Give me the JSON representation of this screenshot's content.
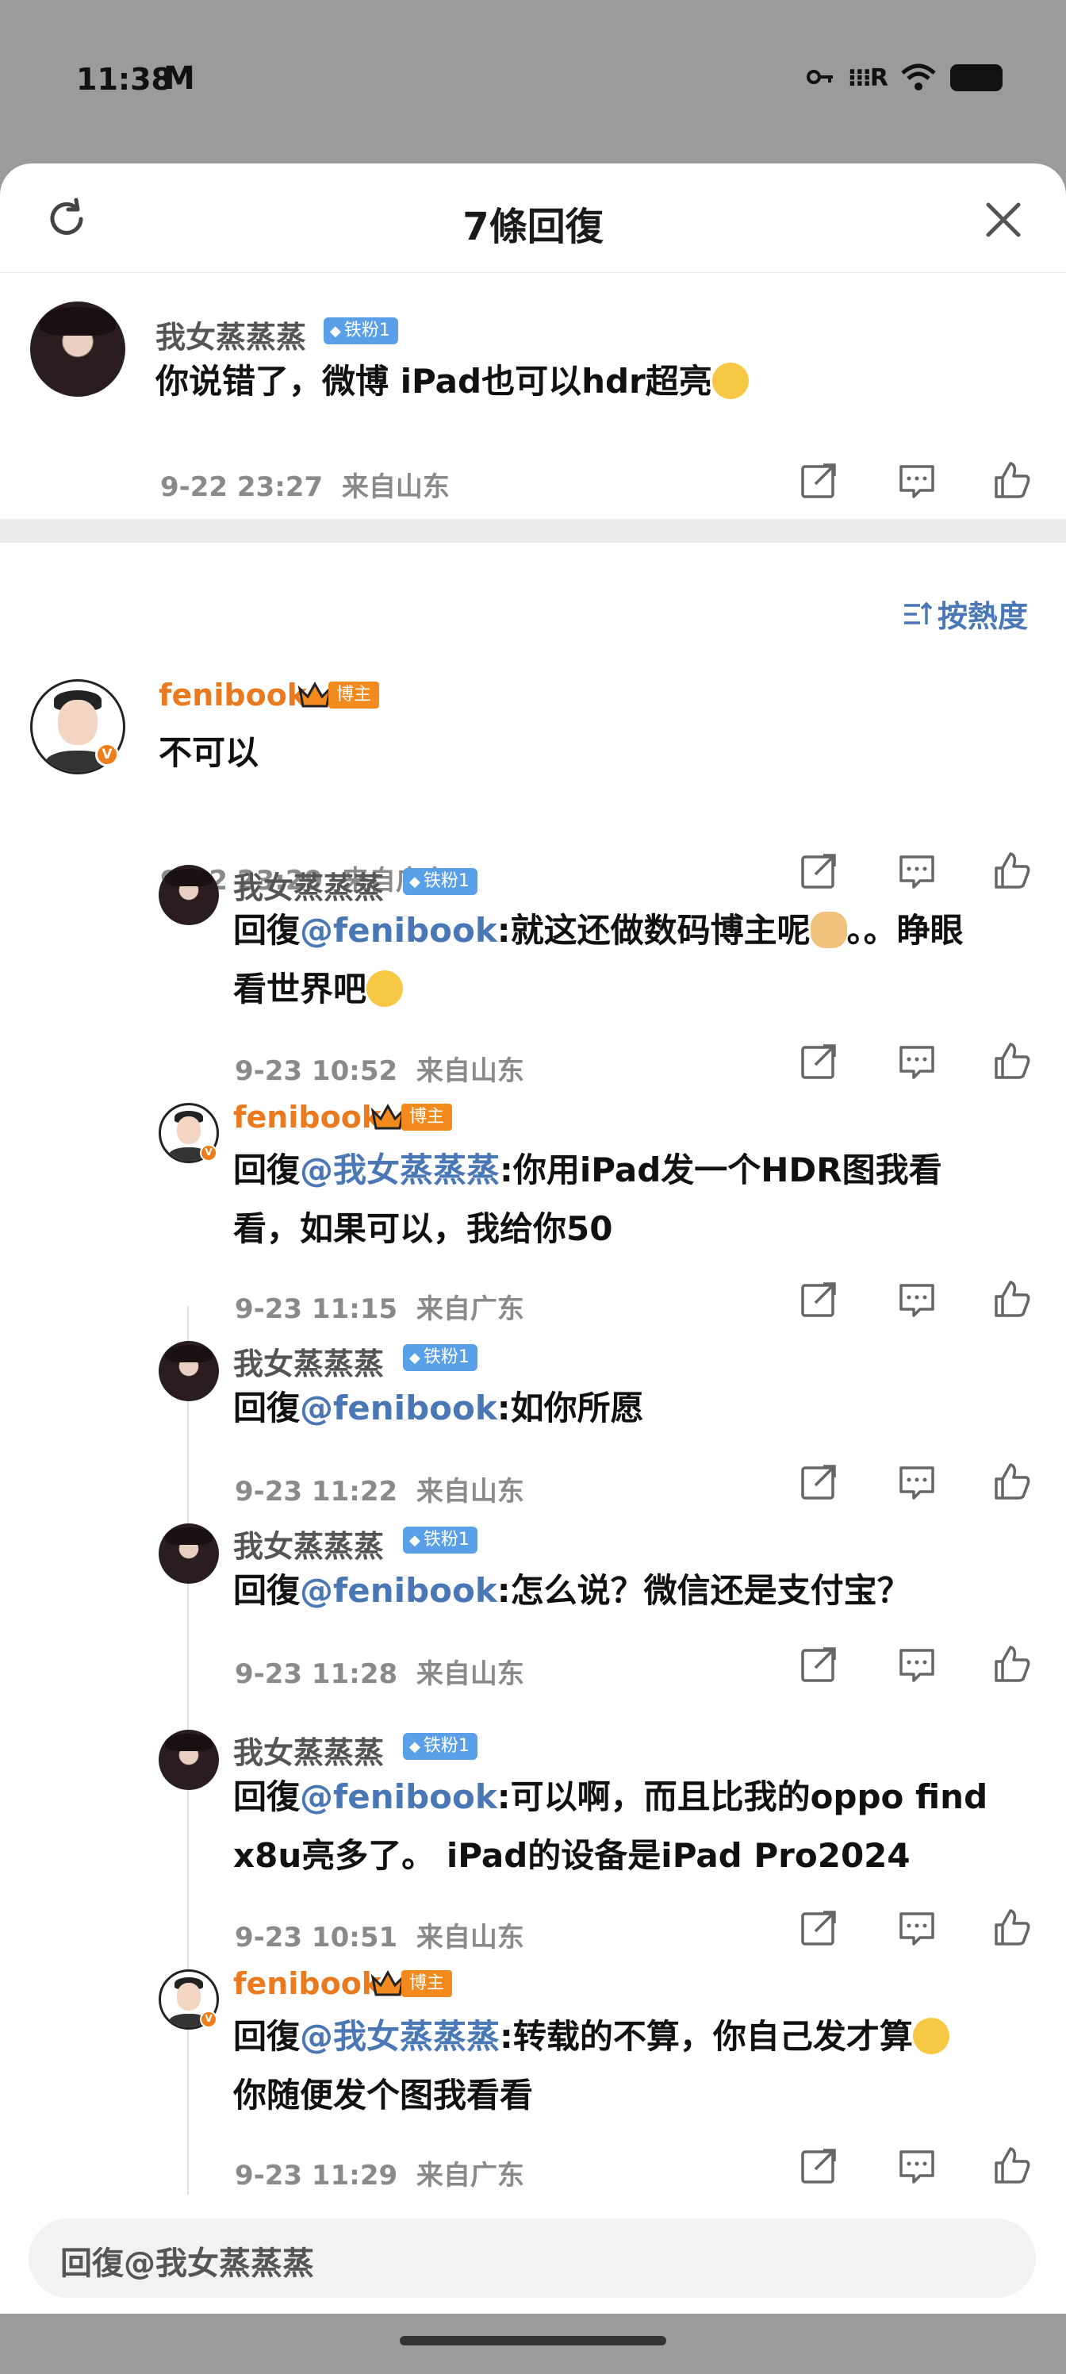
{
  "status_bar": {
    "time": "11:38",
    "mail_glyph": "M",
    "signal": "⁝⁝⁝R"
  },
  "header": {
    "title": "7條回復"
  },
  "root_comment": {
    "author": "我女蒸蒸蒸",
    "badge": "铁粉1",
    "text": "你说错了，微博 iPad也可以hdr超亮",
    "time": "9-22 23:27",
    "location": "来自山东"
  },
  "sort": {
    "label": "按熱度"
  },
  "replies": [
    {
      "author": "fenibook",
      "badge": "博主",
      "text": "不可以",
      "time": "9-22 23:29",
      "location": "来自广东"
    },
    {
      "author": "我女蒸蒸蒸",
      "badge": "铁粉1",
      "prefix": "回復",
      "mention": "@fenibook",
      "text": ":就这还做数码博主呢",
      "text2": "。。睁眼",
      "text3": "看世界吧",
      "time": "9-23 10:52",
      "location": "来自山东"
    },
    {
      "author": "fenibook",
      "badge": "博主",
      "prefix": "回復",
      "mention": "@我女蒸蒸蒸",
      "text": ":你用iPad发一个HDR图我看",
      "text2": "看，如果可以，我给你50",
      "time": "9-23 11:15",
      "location": "来自广东"
    },
    {
      "author": "我女蒸蒸蒸",
      "badge": "铁粉1",
      "prefix": "回復",
      "mention": "@fenibook",
      "text": ":如你所愿",
      "time": "9-23 11:22",
      "location": "来自山东"
    },
    {
      "author": "我女蒸蒸蒸",
      "badge": "铁粉1",
      "prefix": "回復",
      "mention": "@fenibook",
      "text": ":怎么说？微信还是支付宝？",
      "time": "9-23 11:28",
      "location": "来自山东"
    },
    {
      "author": "我女蒸蒸蒸",
      "badge": "铁粉1",
      "prefix": "回復",
      "mention": "@fenibook",
      "text": ":可以啊，而且比我的oppo find",
      "text2": "x8u亮多了。 iPad的设备是iPad Pro2024",
      "time": "9-23 10:51",
      "location": "来自山东"
    },
    {
      "author": "fenibook",
      "badge": "博主",
      "prefix": "回復",
      "mention": "@我女蒸蒸蒸",
      "text": ":转载的不算，你自己发才算",
      "text2": "你随便发个图我看看",
      "time": "9-23 11:29",
      "location": "来自广东"
    }
  ],
  "reply_input": {
    "placeholder": "回復@我女蒸蒸蒸"
  },
  "colors": {
    "accent": "#4a77b6",
    "host": "#eb7a1e",
    "fan": "#5aa0e8"
  }
}
